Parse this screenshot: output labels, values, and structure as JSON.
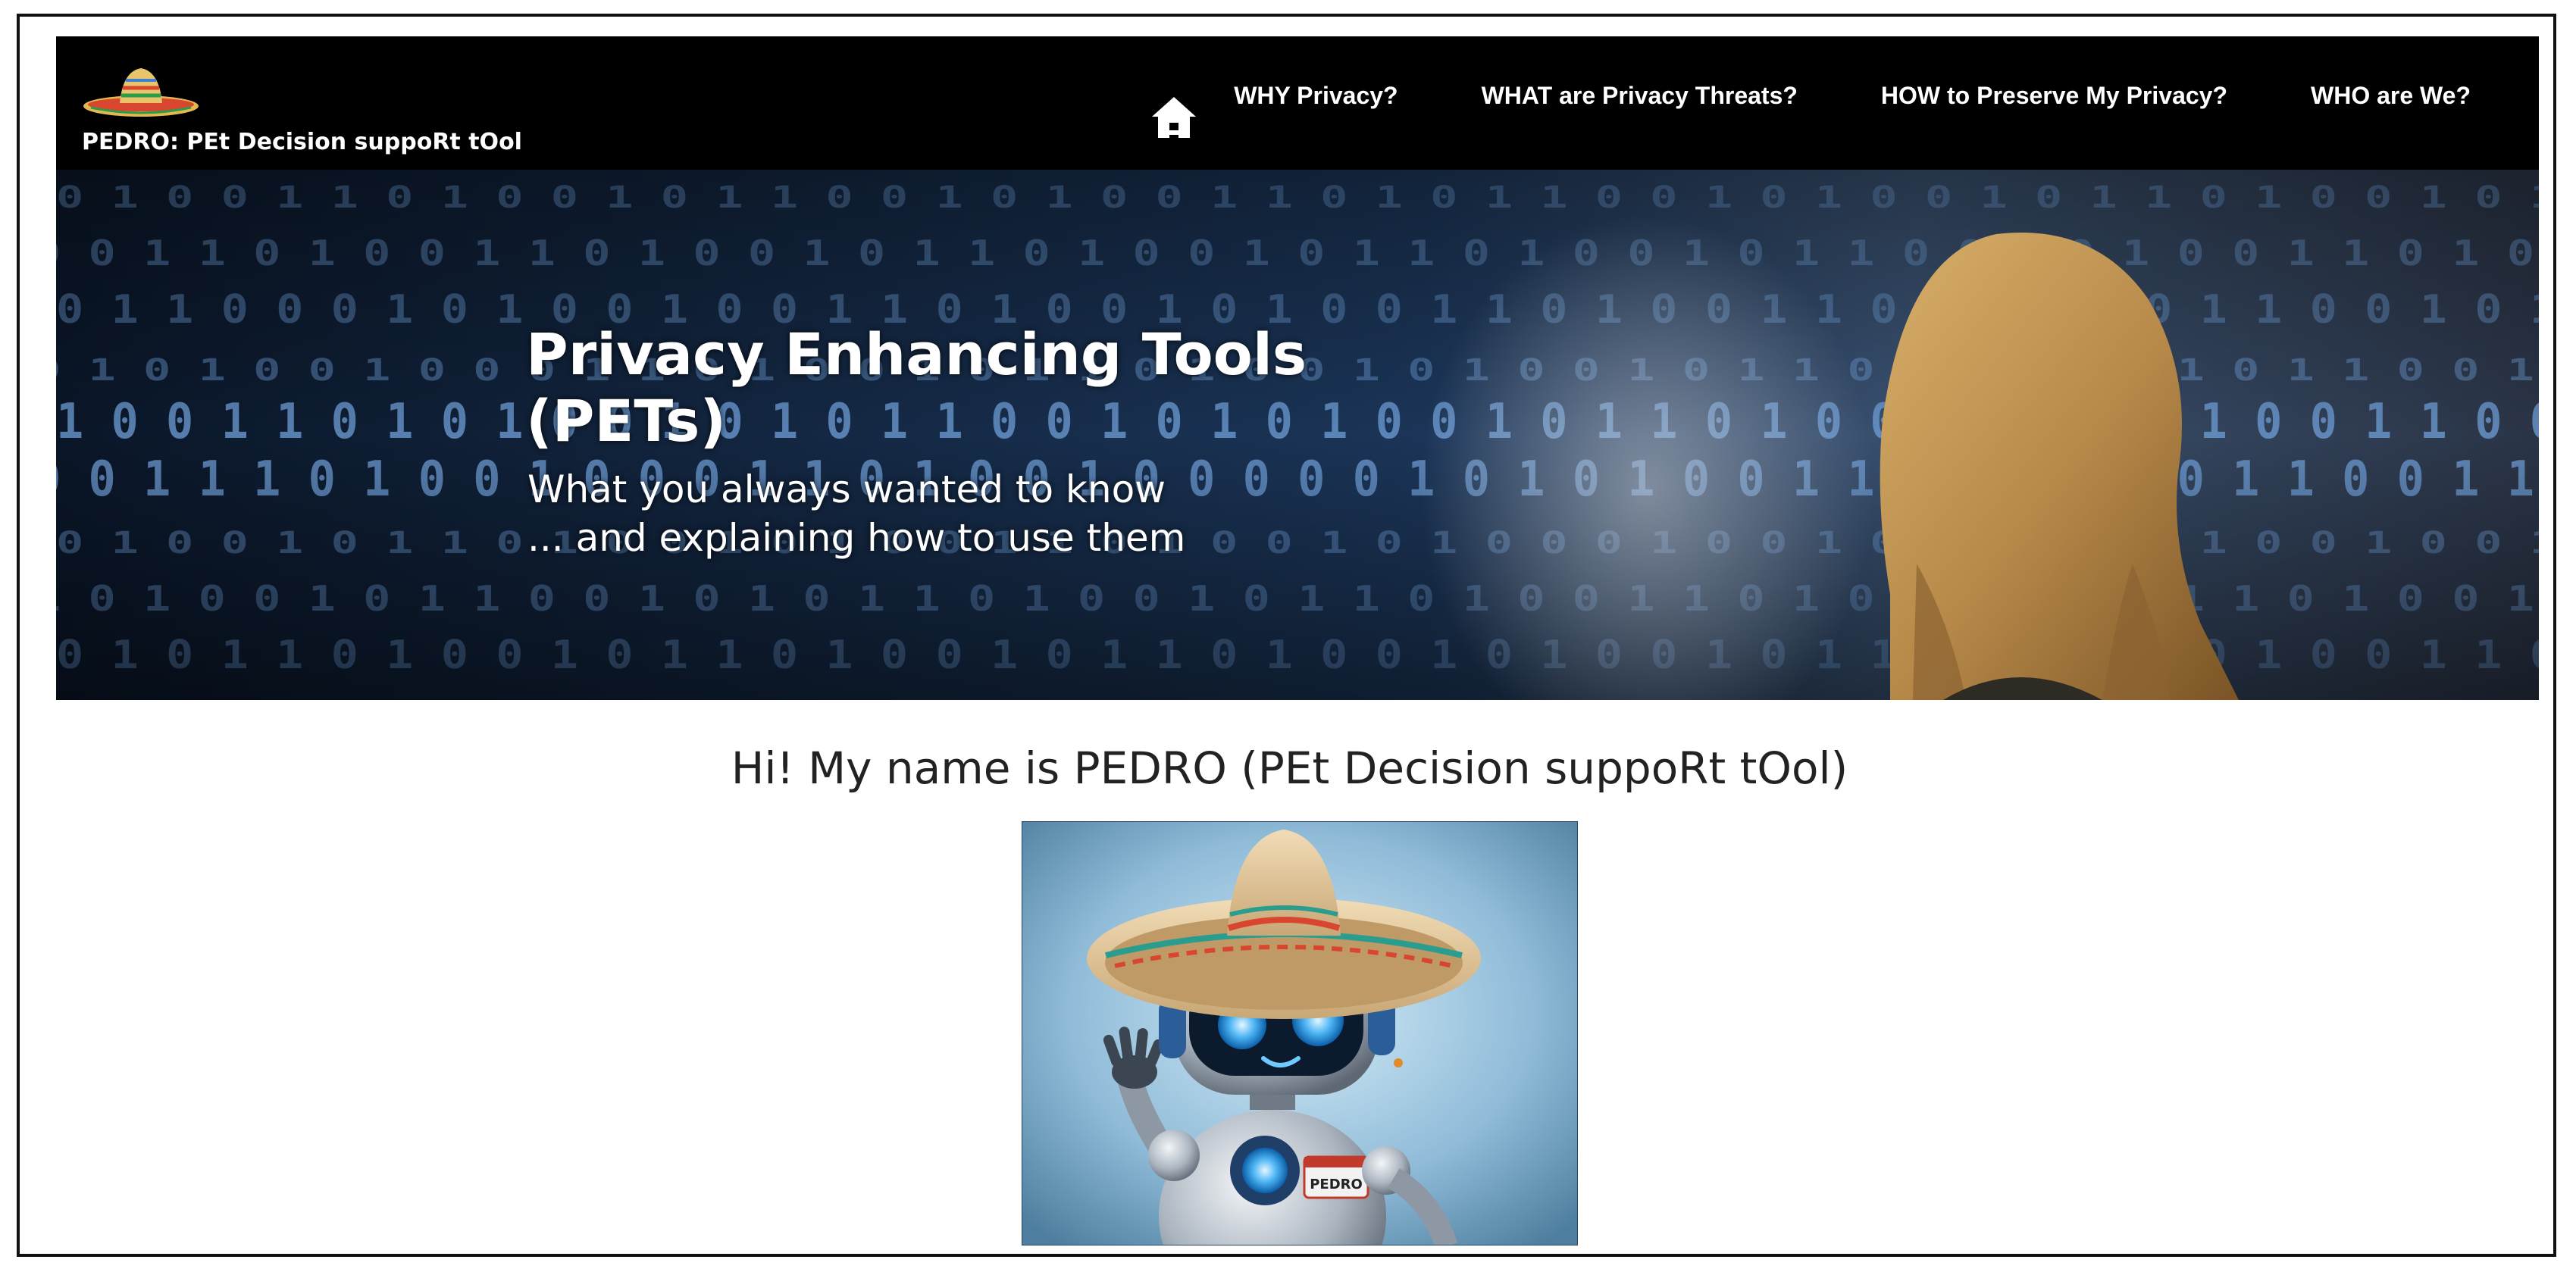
{
  "header": {
    "brand_text": "PEDRO: PEt Decision suppoRt tOol",
    "home_icon": "home-icon",
    "nav": [
      {
        "label": "WHY Privacy?"
      },
      {
        "label": "WHAT are Privacy Threats?"
      },
      {
        "label": "HOW to Preserve My Privacy?"
      },
      {
        "label": "WHO are We?"
      }
    ],
    "background": "#000000"
  },
  "hero": {
    "title": "Privacy Enhancing Tools (PETs)",
    "subtitle_line1": "What you always wanted to know",
    "subtitle_line2": "... and explaining how to use them",
    "binary_rows": [
      "0 1 0 0 1 1 0 1 0 0 1 0 1 1 0 0 1 0 1 0 0 1 1 0 1 0 1 1 0 0 1 0 1 0 0 1 0 1 1 0 1 0 0 1 0 1",
      "0 0 1 1 0 1 0 0 1 1 0 1 0 0 1 0 1 1 0 1 0 0 1 0 1 1 0 1 0 0 1 0 1 1 0 0 1 0 1 0 0 1 1 0 1 0",
      "0 1 1 0 0 0 1 0 1 0 0 1 0 0 1 1 0 1 0 0 1 0 1 0 0 1 1 0 1 0 0 1 1 0 1 0 0 1 0 1 1 0 0 1 0 1",
      "0 1 0 1 0 0 1 0 0 0 1 1 0 1 0 0 1 0 1 1 0 1 0 0 1 0 1 0 0 1 0 1 1 0 1 0 0 1 0 1 0 1 1 0 0 1",
      "1 0 0 1 1 0 1 0 1 0 0 1 0 1 0 1 1 0 0 1 0 1 0 1 0 0 1 0 1 1 0 1 0 0 1 1 0 1 0 1 0 0 1 1 0 0",
      "0 0 1 1 1 0 1 0 0 1 0 0 0 1 1 0 1 0 0 1 0 0 0 0 0 1 0 1 0 1 0 0 1 1 0 0 1 0 1 0 1 1 0 0 1 1",
      "0 1 0 0 1 0 1 1 0 1 0 0 1 0 1 0 0 1 1 0 1 0 0 1 0 1 0 0 0 1 0 0 1 0 1 0 1 1 0 1 0 0 1 0 0 1",
      "1 0 1 0 0 1 0 1 1 0 0 1 0 1 0 1 1 0 1 0 0 1 0 1 1 0 1 0 0 1 1 0 1 0 0 1 0 1 0 1 1 0 1 0 0 1",
      "0 1 0 1 1 0 1 0 0 1 0 1 1 0 1 0 0 1 0 1 1 0 1 0 0 1 0 1 0 0 1 0 1 1 0 1 0 0 1 0 1 0 0 1 1 0"
    ]
  },
  "main": {
    "heading": "Hi! My name is PEDRO (PEt Decision suppoRt tOol)",
    "robot_badge": "PEDRO"
  },
  "colors": {
    "hero_dark": "#0b1a2e",
    "binary_blue": "#6f9fd8",
    "hair": "#b88a4a",
    "sky_blue": "#8fbbd8"
  }
}
